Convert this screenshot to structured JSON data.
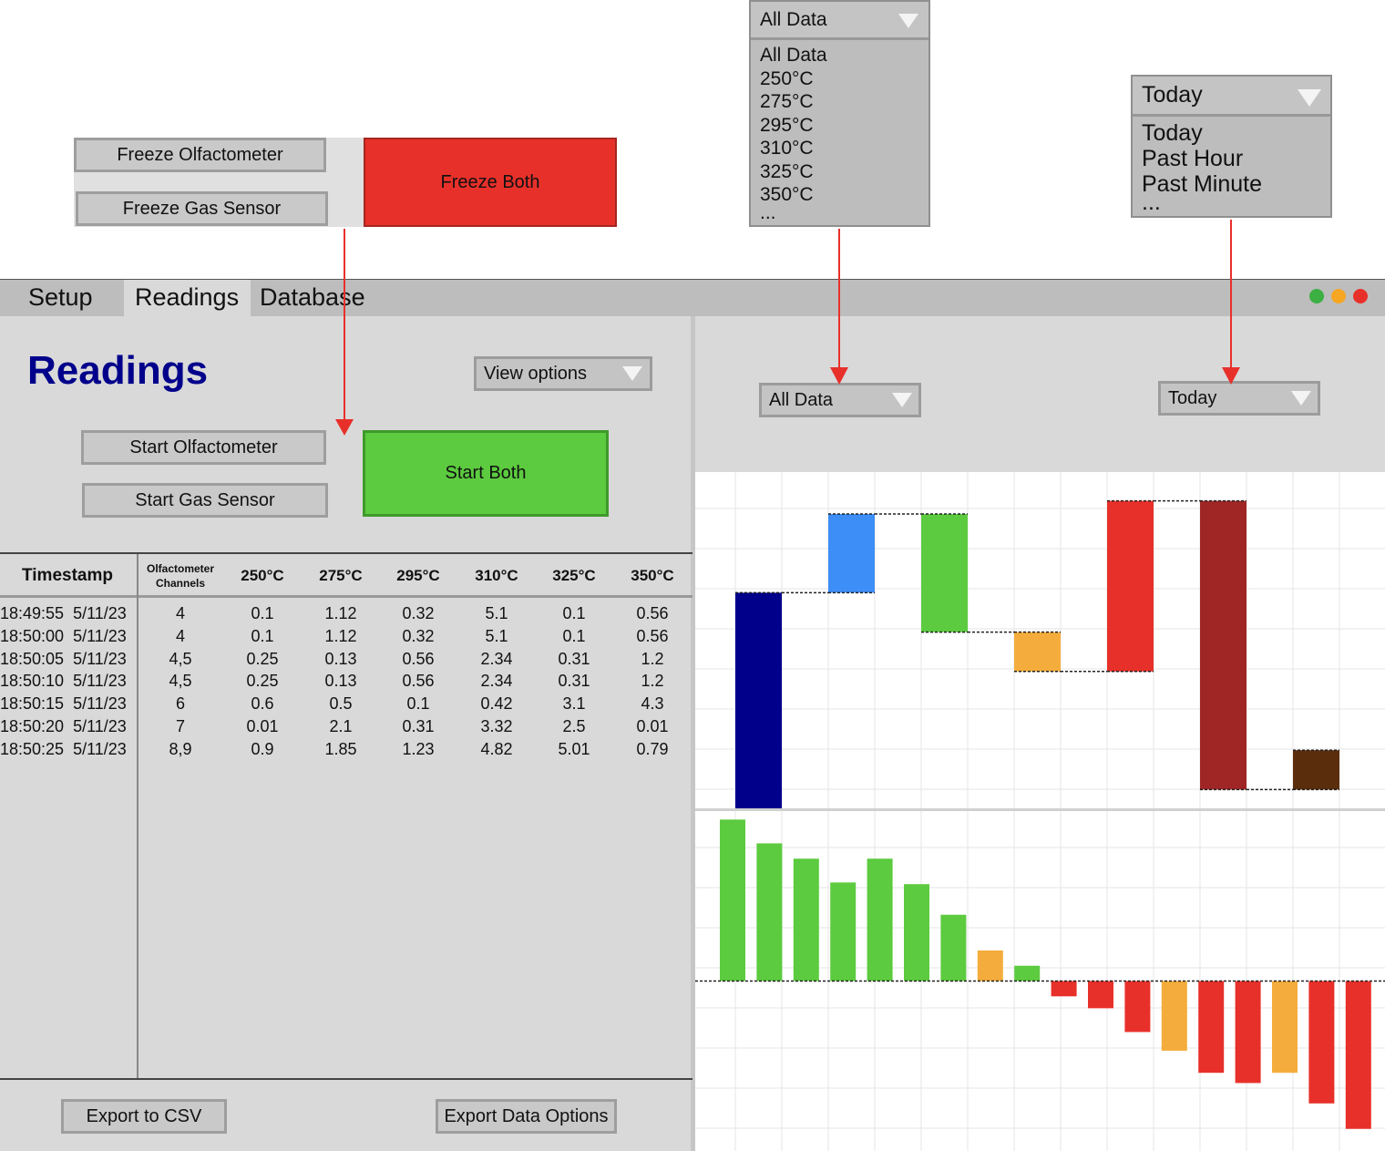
{
  "mockups": {
    "freeze_olfactometer": "Freeze Olfactometer",
    "freeze_gas_sensor": "Freeze Gas Sensor",
    "freeze_both": "Freeze Both",
    "temp_dropdown": {
      "selected": "All Data",
      "options": [
        "All Data",
        "250°C",
        "275°C",
        "295°C",
        "310°C",
        "325°C",
        "350°C",
        "..."
      ]
    },
    "time_dropdown": {
      "selected": "Today",
      "options": [
        "Today",
        "Past Hour",
        "Past Minute",
        "..."
      ]
    }
  },
  "tabs": [
    "Setup",
    "Readings",
    "Database"
  ],
  "window_dots": [
    "#3cb043",
    "#f5a623",
    "#e8302a"
  ],
  "left": {
    "title": "Readings",
    "view_options": "View options",
    "start_olfactometer": "Start Olfactometer",
    "start_gas_sensor": "Start Gas Sensor",
    "start_both": "Start Both",
    "export_csv": "Export to CSV",
    "export_options": "Export Data Options"
  },
  "table": {
    "headers": [
      "Timestamp",
      "Olfactometer Channels",
      "250°C",
      "275°C",
      "295°C",
      "310°C",
      "325°C",
      "350°C"
    ],
    "rows": [
      [
        "18:49:55  5/11/23",
        "4",
        "0.1",
        "1.12",
        "0.32",
        "5.1",
        "0.1",
        "0.56"
      ],
      [
        "18:50:00  5/11/23",
        "4",
        "0.1",
        "1.12",
        "0.32",
        "5.1",
        "0.1",
        "0.56"
      ],
      [
        "18:50:05  5/11/23",
        "4,5",
        "0.25",
        "0.13",
        "0.56",
        "2.34",
        "0.31",
        "1.2"
      ],
      [
        "18:50:10  5/11/23",
        "4,5",
        "0.25",
        "0.13",
        "0.56",
        "2.34",
        "0.31",
        "1.2"
      ],
      [
        "18:50:15  5/11/23",
        "6",
        "0.6",
        "0.5",
        "0.1",
        "0.42",
        "3.1",
        "4.3"
      ],
      [
        "18:50:20  5/11/23",
        "7",
        "0.01",
        "2.1",
        "0.31",
        "3.32",
        "2.5",
        "0.01"
      ],
      [
        "18:50:25  5/11/23",
        "8,9",
        "0.9",
        "1.85",
        "1.23",
        "4.82",
        "5.01",
        "0.79"
      ]
    ]
  },
  "right": {
    "temp_filter": "All Data",
    "time_filter": "Today"
  },
  "colors": {
    "freeze_red": "#e8302a",
    "start_green": "#5ccb3f",
    "arrow_red": "#e8302a",
    "title_blue": "#00008b"
  },
  "chart_data": [
    {
      "type": "bar",
      "subtype": "waterfall",
      "bars": [
        {
          "base": 0,
          "top": 66,
          "color": "#00008b"
        },
        {
          "base": 66,
          "top": 90,
          "color": "#3d8ef7"
        },
        {
          "base": 54,
          "top": 90,
          "color": "#5ccb3f"
        },
        {
          "base": 42,
          "top": 54,
          "color": "#f4ad3c"
        },
        {
          "base": 42,
          "top": 94,
          "color": "#e8302a"
        },
        {
          "base": 6,
          "top": 94,
          "color": "#a02626"
        },
        {
          "base": 6,
          "top": 18,
          "color": "#5a2d0c"
        }
      ],
      "ylim": [
        0,
        100
      ],
      "grid": true
    },
    {
      "type": "bar",
      "values": [
        19,
        16.2,
        14.4,
        11.6,
        14.4,
        11.4,
        7.8,
        3.6,
        1.8,
        -1.8,
        -3.2,
        -6,
        -8.2,
        -10.8,
        -12,
        -10.8,
        -14.4,
        -17.4
      ],
      "colors": [
        "#5ccb3f",
        "#5ccb3f",
        "#5ccb3f",
        "#5ccb3f",
        "#5ccb3f",
        "#5ccb3f",
        "#5ccb3f",
        "#f4ad3c",
        "#5ccb3f",
        "#e8302a",
        "#e8302a",
        "#e8302a",
        "#f4ad3c",
        "#e8302a",
        "#e8302a",
        "#f4ad3c",
        "#e8302a",
        "#e8302a"
      ],
      "ylim": [
        -20,
        20
      ],
      "grid": true
    }
  ]
}
